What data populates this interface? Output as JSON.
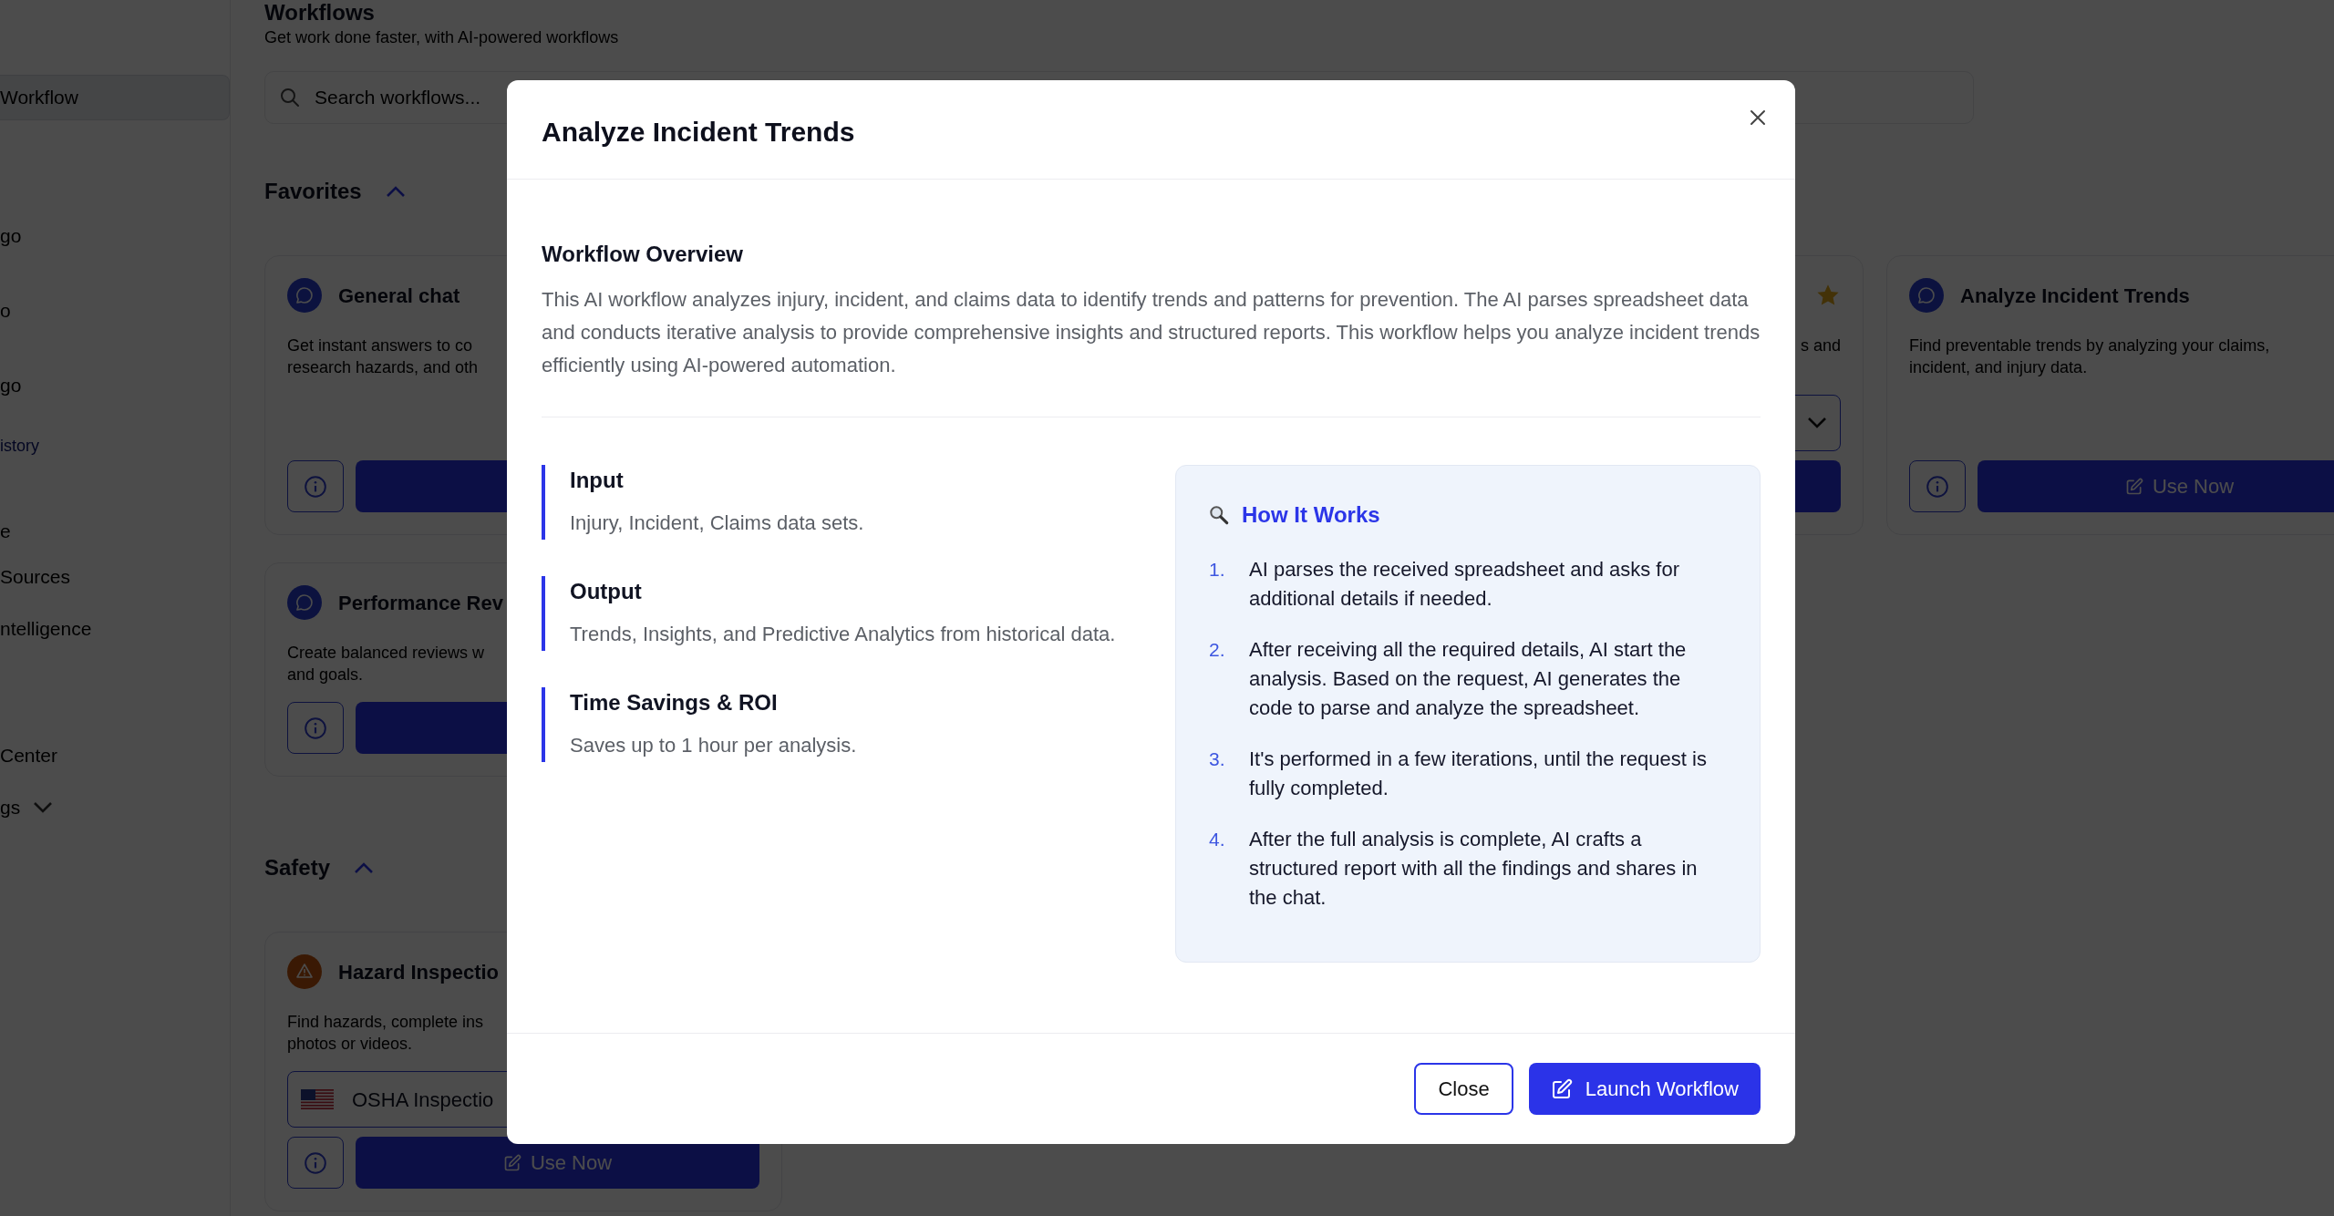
{
  "sidebar": {
    "items": [
      {
        "label": "Workflow",
        "kind": "item",
        "selected": true
      },
      {
        "label": "go",
        "kind": "item",
        "selected": false
      },
      {
        "label": "o",
        "kind": "item",
        "selected": false
      },
      {
        "label": "go",
        "kind": "item",
        "selected": false
      },
      {
        "label": "istory",
        "kind": "link",
        "selected": false
      },
      {
        "label": "e",
        "kind": "item",
        "selected": false
      },
      {
        "label": "Sources",
        "kind": "item",
        "selected": false
      },
      {
        "label": "ntelligence",
        "kind": "item",
        "selected": false
      },
      {
        "label": "Center",
        "kind": "item",
        "selected": false
      },
      {
        "label": "gs",
        "kind": "group",
        "selected": false,
        "expanded": false
      }
    ]
  },
  "page": {
    "title": "Workflows",
    "subtitle": "Get work done faster, with AI-powered workflows",
    "search": {
      "placeholder": "Search workflows..."
    }
  },
  "sections": [
    {
      "title": "Favorites",
      "expanded": true,
      "rows": [
        [
          {
            "kind": "chat",
            "title": "General chat",
            "description_lines": [
              "Get instant answers to co",
              "research hazards, and oth"
            ]
          },
          {
            "kind": "covered"
          },
          {
            "kind": "partial",
            "favorite": true,
            "description_lines": [
              "s and"
            ],
            "select": {
              "kind": "plain"
            }
          },
          {
            "kind": "chat",
            "title": "Analyze Incident Trends",
            "description_lines": [
              "Find preventable trends by analyzing your claims,",
              "incident, and injury data."
            ],
            "button": "Use Now"
          }
        ],
        [
          {
            "kind": "chat",
            "title": "Performance Rev",
            "description_lines": [
              "Create balanced reviews w",
              "and goals."
            ]
          }
        ]
      ]
    },
    {
      "title": "Safety",
      "expanded": true,
      "rows": [
        [
          {
            "kind": "warning",
            "title": "Hazard Inspectio",
            "description_lines": [
              "Find hazards, complete ins",
              "photos or videos."
            ],
            "select": {
              "kind": "flag",
              "label": "OSHA Inspectio"
            },
            "button": "Use Now"
          }
        ]
      ]
    }
  ],
  "modal": {
    "title": "Analyze Incident Trends",
    "overview": {
      "heading": "Workflow Overview",
      "text": "This AI workflow analyzes injury, incident, and claims data to identify trends and patterns for prevention. The AI parses spreadsheet data and conducts iterative analysis to provide comprehensive insights and structured reports. This workflow helps you analyze incident trends efficiently using AI-powered automation."
    },
    "details": [
      {
        "label": "Input",
        "text": "Injury, Incident, Claims data sets."
      },
      {
        "label": "Output",
        "text": "Trends, Insights, and Predictive Analytics from historical data."
      },
      {
        "label": "Time Savings & ROI",
        "text": "Saves up to 1 hour per analysis."
      }
    ],
    "how_it_works": {
      "title": "How It Works",
      "steps": [
        {
          "number": "1.",
          "text": "AI parses the received spreadsheet and asks for additional details if needed."
        },
        {
          "number": "2.",
          "text": "After receiving all the required details, AI start the analysis. Based on the request, AI generates the code to parse and analyze the spreadsheet."
        },
        {
          "number": "3.",
          "text": "It's performed in a few iterations, until the request is fully completed."
        },
        {
          "number": "4.",
          "text": "After the full analysis is complete, AI crafts a structured report with all the findings and shares in the chat."
        }
      ]
    },
    "buttons": [
      {
        "label": "Close",
        "kind": "secondary"
      },
      {
        "label": "Launch Workflow",
        "kind": "primary"
      }
    ]
  }
}
